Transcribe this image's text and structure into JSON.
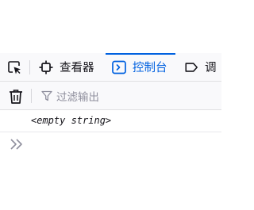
{
  "colors": {
    "accent": "#0061e0",
    "toolbar_bg": "#f9f9fb",
    "placeholder": "#8f8f9d",
    "text": "#15141a"
  },
  "tabs": {
    "picker_icon": "element-picker-icon",
    "inspector": {
      "label": "查看器",
      "icon": "inspector-icon"
    },
    "console": {
      "label": "控制台",
      "icon": "console-icon",
      "selected": true
    },
    "debugger": {
      "label": "调",
      "icon": "debugger-icon"
    }
  },
  "filterbar": {
    "clear_icon": "trash-icon",
    "filter_icon": "filter-funnel-icon",
    "placeholder": "过滤输出"
  },
  "console": {
    "output": "<empty string>",
    "prompt_icon": "double-chevron-right-icon"
  }
}
